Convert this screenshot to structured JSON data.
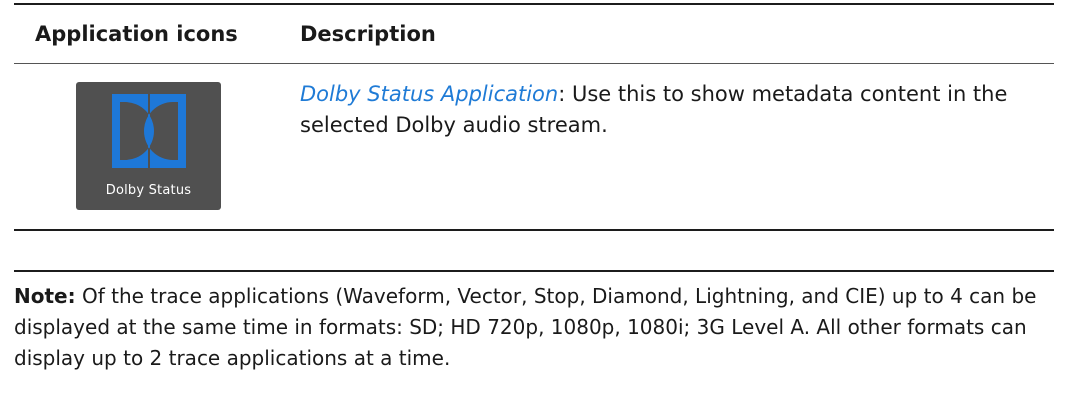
{
  "table": {
    "headers": {
      "icons": "Application icons",
      "description": "Description"
    },
    "rows": [
      {
        "icon": {
          "name": "dolby-status-icon",
          "label": "Dolby Status",
          "colors": {
            "background": "#505050",
            "symbol": "#1e78d8"
          }
        },
        "link_text": "Dolby Status Application",
        "description": ": Use this to show metadata content in the selected Dolby audio stream."
      }
    ]
  },
  "note": {
    "label": "Note:",
    "text": "  Of the trace applications (Waveform, Vector, Stop, Diamond, Lightning, and CIE) up to 4 can be displayed at the same time in formats: SD; HD 720p, 1080p, 1080i; 3G Level A. All other formats can display up to 2 trace applications at a time."
  },
  "colors": {
    "link": "#1f7bd6",
    "rule": "#1c1c1c"
  }
}
